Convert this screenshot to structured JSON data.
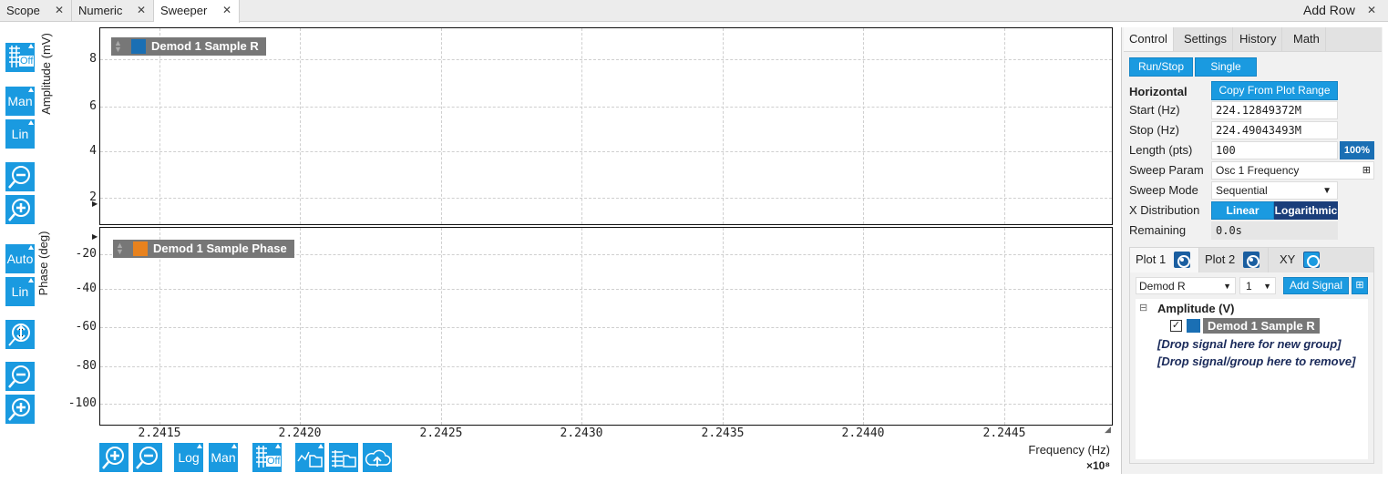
{
  "tabs": [
    {
      "label": "Scope"
    },
    {
      "label": "Numeric"
    },
    {
      "label": "Sweeper"
    }
  ],
  "add_row": "Add Row",
  "left_toolbar": {
    "off": "Off",
    "man": "Man",
    "lin": "Lin",
    "auto": "Auto",
    "lin2": "Lin"
  },
  "upper_plot": {
    "ylabel": "Amplitude (mV)",
    "legend": "Demod 1 Sample R",
    "legend_color": "#1a6fb4",
    "yticks": [
      "8",
      "6",
      "4",
      "2"
    ]
  },
  "lower_plot": {
    "ylabel": "Phase (deg)",
    "legend": "Demod 1 Sample Phase",
    "legend_color": "#e8821e",
    "yticks": [
      "-20",
      "-40",
      "-60",
      "-80",
      "-100"
    ]
  },
  "x_axis": {
    "ticks": [
      "2.2415",
      "2.2420",
      "2.2425",
      "2.2430",
      "2.2435",
      "2.2440",
      "2.2445"
    ],
    "label": "Frequency (Hz)",
    "multiplier": "×10⁸"
  },
  "bottom_toolbar": {
    "log": "Log",
    "man": "Man",
    "off": "Off"
  },
  "right": {
    "tabs": [
      "Control",
      "Settings",
      "History",
      "Math"
    ],
    "run_stop": "Run/Stop",
    "single": "Single",
    "horizontal": "Horizontal",
    "copy": "Copy From Plot Range",
    "start_label": "Start (Hz)",
    "start_value": "224.12849372M",
    "stop_label": "Stop (Hz)",
    "stop_value": "224.49043493M",
    "length_label": "Length (pts)",
    "length_value": "100",
    "length_pct": "100%",
    "sweep_param_label": "Sweep Param",
    "sweep_param_value": "Osc 1 Frequency",
    "sweep_mode_label": "Sweep Mode",
    "sweep_mode_value": "Sequential",
    "xdist_label": "X Distribution",
    "linear": "Linear",
    "log": "Logarithmic",
    "remaining_label": "Remaining",
    "remaining_value": "0.0s",
    "plot_tabs": [
      "Plot 1",
      "Plot 2",
      "XY"
    ],
    "signal_select": "Demod R",
    "index_select": "1",
    "add_signal": "Add Signal",
    "tree_group": "Amplitude (V)",
    "tree_item": "Demod 1 Sample R",
    "drop_new": "[Drop signal here for new group]",
    "drop_remove": "[Drop signal/group here to remove]"
  }
}
